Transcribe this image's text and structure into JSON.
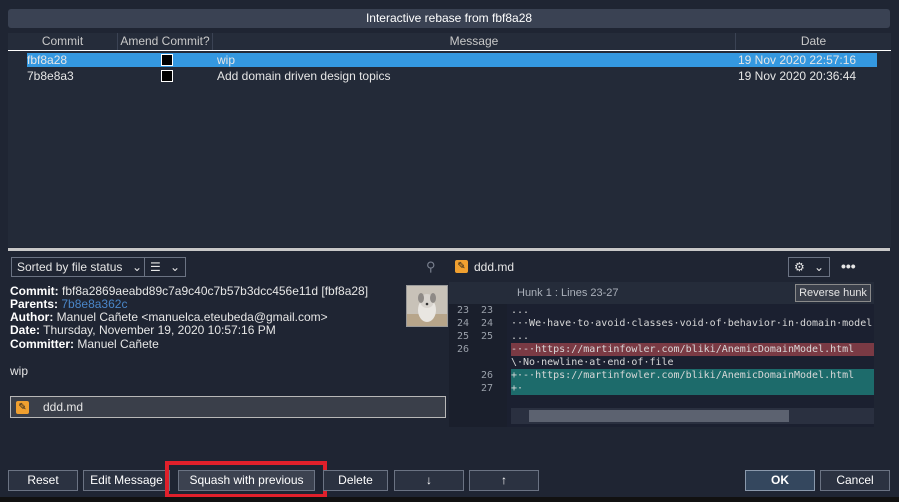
{
  "window": {
    "title": "Interactive rebase from fbf8a28"
  },
  "grid": {
    "headers": {
      "commit": "Commit",
      "amend": "Amend Commit?",
      "message": "Message",
      "date": "Date"
    },
    "rows": [
      {
        "commit": "fbf8a28",
        "amend": false,
        "message": "wip",
        "date": "19 Nov 2020 22:57:16",
        "selected": true
      },
      {
        "commit": "7b8e8a3",
        "amend": false,
        "message": "Add domain driven design topics",
        "date": "19 Nov 2020 20:36:44",
        "selected": false
      }
    ]
  },
  "left_pane": {
    "sort_dropdown": "Sorted by file status",
    "view_icon": "list-icon",
    "commit": {
      "label": "Commit:",
      "value": "fbf8a2869aeabd89c7a9c40c7b57b3dcc456e11d [fbf8a28]"
    },
    "parents": {
      "label": "Parents:",
      "value": "7b8e8a362c"
    },
    "author": {
      "label": "Author:",
      "value": "Manuel Cañete <manuelca.eteubeda@gmail.com>"
    },
    "date": {
      "label": "Date:",
      "value": "Thursday, November 19, 2020 10:57:16 PM"
    },
    "committer": {
      "label": "Committer:",
      "value": "Manuel Cañete"
    },
    "message": "wip",
    "files": [
      {
        "name": "ddd.md",
        "icon": "edit-file-icon"
      }
    ]
  },
  "right_pane": {
    "file_name": "ddd.md",
    "hunk_title": "Hunk 1 : Lines 23-27",
    "reverse_hunk": "Reverse hunk",
    "lines": [
      {
        "old": "23",
        "new": "23",
        "type": "ctx",
        "text": "..."
      },
      {
        "old": "24",
        "new": "24",
        "type": "ctx",
        "text": "···We·have·to·avoid·classes·void·of·behavior·in·domain·model"
      },
      {
        "old": "25",
        "new": "25",
        "type": "ctx",
        "text": "..."
      },
      {
        "old": "26",
        "new": "",
        "type": "del",
        "text": "-·-·https://martinfowler.com/bliki/AnemicDomainModel.html"
      },
      {
        "old": "",
        "new": "",
        "type": "ctx",
        "text": "\\·No·newline·at·end·of·file"
      },
      {
        "old": "",
        "new": "26",
        "type": "add",
        "text": "+·-·https://martinfowler.com/bliki/AnemicDomainModel.html"
      },
      {
        "old": "",
        "new": "27",
        "type": "add",
        "text": "+·"
      }
    ]
  },
  "buttons": {
    "reset": "Reset",
    "edit_message": "Edit Message",
    "squash": "Squash with previous",
    "delete": "Delete",
    "down": "↓",
    "up": "↑",
    "ok": "OK",
    "cancel": "Cancel"
  },
  "colors": {
    "selection": "#3498e0",
    "highlight_box": "#e0202b",
    "deleted_line": "#7a3a44",
    "added_line": "#1d6b6b"
  }
}
